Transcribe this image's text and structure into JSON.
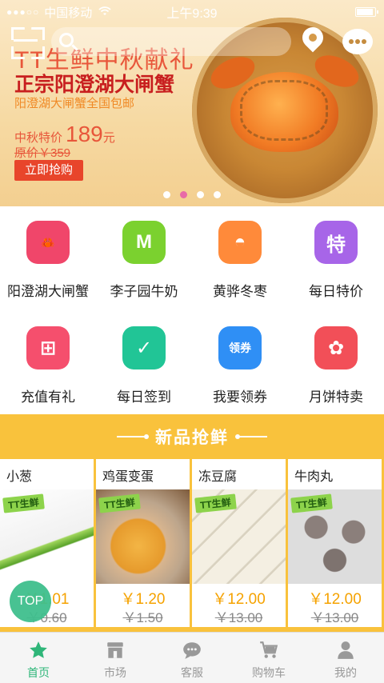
{
  "status": {
    "carrier": "中国移动",
    "time": "上午9:39"
  },
  "banner": {
    "title": "TT生鲜中秋献礼",
    "subtitle": "正宗阳澄湖大闸蟹",
    "shipping": "阳澄湖大闸蟹全国包邮",
    "price_label": "中秋特价",
    "price": "189",
    "price_unit": "元",
    "original": "原价￥359",
    "button": "立即抢购",
    "active_slide": 2,
    "slide_count": 4
  },
  "categories": [
    {
      "label": "阳澄湖大闸蟹",
      "icon": "crab-icon",
      "color": "#f0466a",
      "glyph": "🦀"
    },
    {
      "label": "李子园牛奶",
      "icon": "milk-icon",
      "color": "#7bd12f",
      "glyph": "M"
    },
    {
      "label": "黄骅冬枣",
      "icon": "jujube-icon",
      "color": "#ff8a3a",
      "glyph": "◓"
    },
    {
      "label": "每日特价",
      "icon": "special-tag-icon",
      "color": "#a765e8",
      "glyph": "特"
    },
    {
      "label": "充值有礼",
      "icon": "gift-icon",
      "color": "#f54f6d",
      "glyph": "⊞"
    },
    {
      "label": "每日签到",
      "icon": "checkin-icon",
      "color": "#21c596",
      "glyph": "✓"
    },
    {
      "label": "我要领券",
      "icon": "coupon-icon",
      "color": "#2f8ff5",
      "glyph": "领券"
    },
    {
      "label": "月饼特卖",
      "icon": "mooncake-icon",
      "color": "#f24f58",
      "glyph": "✿"
    }
  ],
  "fresh": {
    "title": "新品抢鲜",
    "brand_tag": "TT生鲜",
    "products": [
      {
        "name": "小葱",
        "price": "￥1.01",
        "old": "￥0.60"
      },
      {
        "name": "鸡蛋变蛋",
        "price": "￥1.20",
        "old": "￥1.50"
      },
      {
        "name": "冻豆腐",
        "price": "￥12.00",
        "old": "￥13.00"
      },
      {
        "name": "牛肉丸",
        "price": "￥12.00",
        "old": "￥13.00"
      }
    ]
  },
  "top_button": "TOP",
  "tabs": [
    {
      "label": "首页",
      "icon": "star-icon",
      "active": true
    },
    {
      "label": "市场",
      "icon": "market-icon",
      "active": false
    },
    {
      "label": "客服",
      "icon": "chat-icon",
      "active": false
    },
    {
      "label": "购物车",
      "icon": "cart-icon",
      "active": false
    },
    {
      "label": "我的",
      "icon": "user-icon",
      "active": false
    }
  ],
  "colors": {
    "accent": "#2fb679",
    "banner_red": "#e8452b",
    "section": "#f9c23c",
    "price": "#f5a200"
  }
}
